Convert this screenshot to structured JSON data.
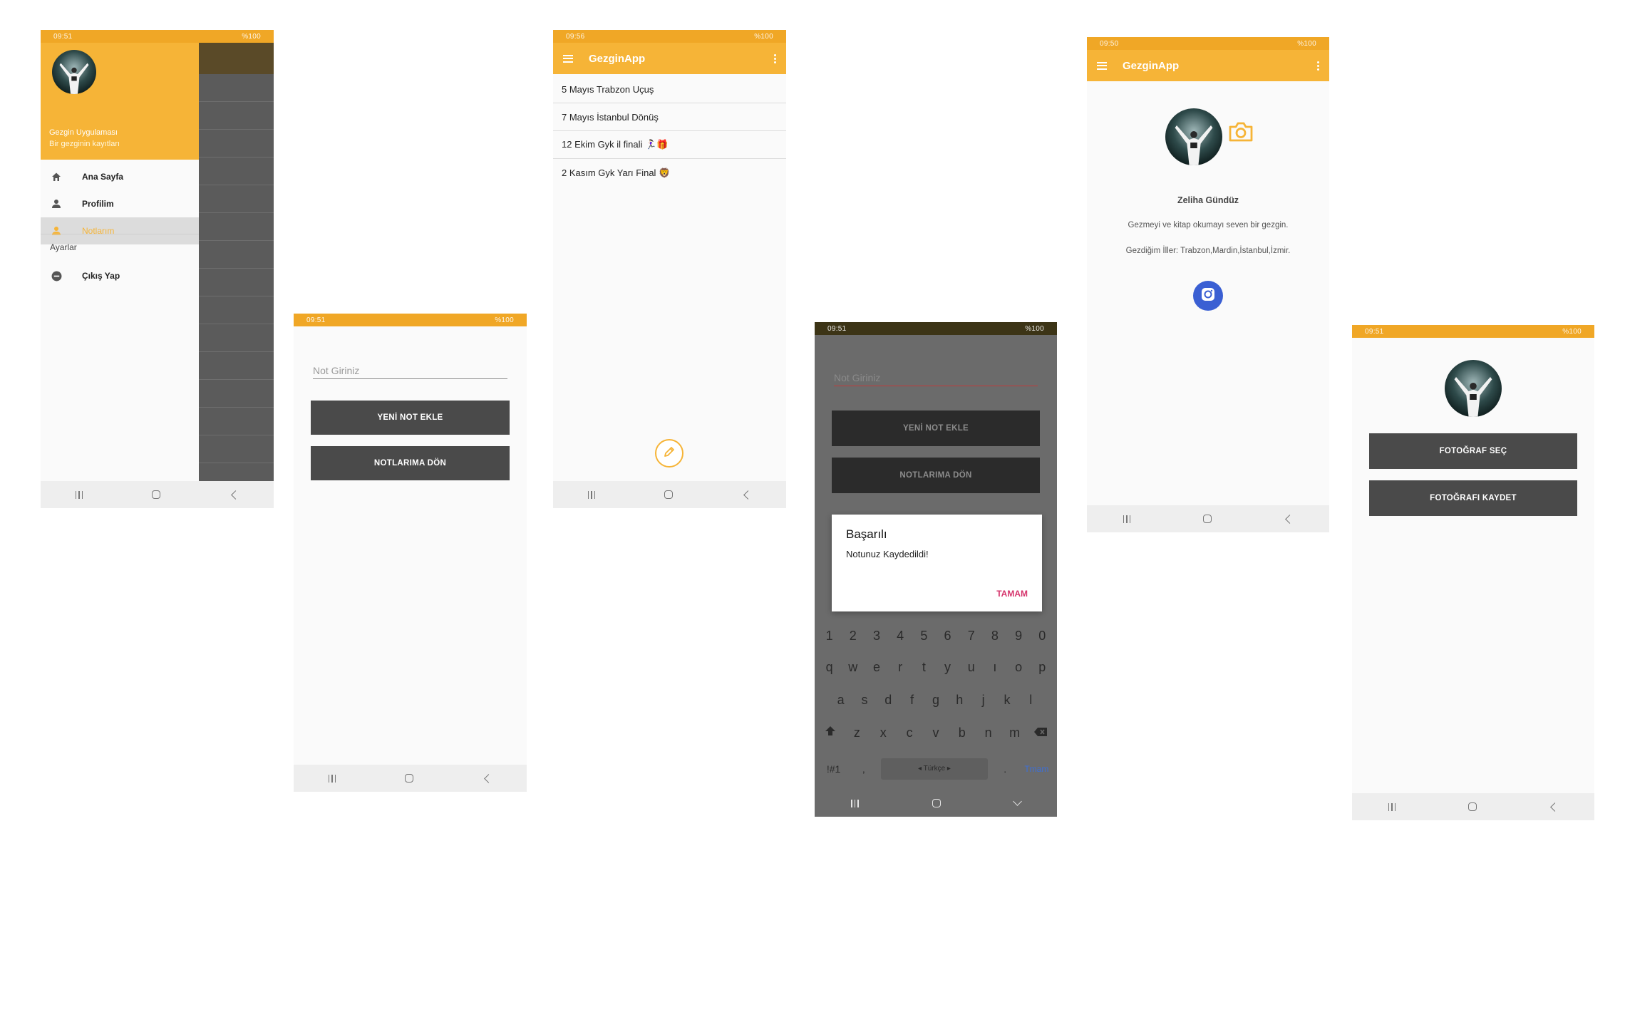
{
  "colors": {
    "accent": "#f6b437",
    "dark_button": "#4a4a4a",
    "dialog_action": "#d5336b",
    "instagram": "#3a5fd3"
  },
  "screens": {
    "drawer": {
      "status_time": "09:51",
      "status_right": "%100",
      "header_title": "Gezgin Uygulaması",
      "header_subtitle": "Bir gezginin kayıtları",
      "menu": [
        {
          "label": "Ana Sayfa",
          "icon": "home-icon"
        },
        {
          "label": "Profilim",
          "icon": "person-icon"
        },
        {
          "label": "Notlarım",
          "icon": "person-icon",
          "active": true
        }
      ],
      "section_label": "Ayarlar",
      "logout_label": "Çıkış Yap"
    },
    "add_note": {
      "status_time": "09:51",
      "status_right": "%100",
      "input_placeholder": "Not Giriniz",
      "add_button": "YENİ NOT EKLE",
      "back_button": "NOTLARIMA DÖN"
    },
    "notes_list": {
      "status_time": "09:56",
      "status_right": "%100",
      "app_title": "GezginApp",
      "items": [
        "5 Mayıs Trabzon Uçuş",
        "7 Mayıs İstanbul Dönüş",
        "12 Ekim Gyk il finali 🏃🏻‍♀️🎁",
        "2 Kasım Gyk Yarı Final 🦁"
      ]
    },
    "saved_dialog": {
      "status_time": "09:51",
      "status_right": "%100",
      "input_placeholder": "Not Giriniz",
      "add_button": "YENİ NOT EKLE",
      "back_button": "NOTLARIMA DÖN",
      "dialog_title": "Başarılı",
      "dialog_message": "Notunuz Kaydedildi!",
      "dialog_button": "TAMAM",
      "keyboard": {
        "numbers": [
          "1",
          "2",
          "3",
          "4",
          "5",
          "6",
          "7",
          "8",
          "9",
          "0"
        ],
        "row1": [
          "q",
          "w",
          "e",
          "r",
          "t",
          "y",
          "u",
          "ı",
          "o",
          "p"
        ],
        "row2": [
          "a",
          "s",
          "d",
          "f",
          "g",
          "h",
          "j",
          "k",
          "l"
        ],
        "row3": [
          "z",
          "x",
          "c",
          "v",
          "b",
          "n",
          "m"
        ],
        "sym": "!#1",
        "comma": ",",
        "space": "◂ Türkçe ▸",
        "dot": ".",
        "done": "Tmam"
      }
    },
    "profile": {
      "status_time": "09:50",
      "status_right": "%100",
      "app_title": "GezginApp",
      "name": "Zeliha Gündüz",
      "bio": "Gezmeyi ve kitap okumayı seven bir gezgin.",
      "cities": "Gezdiğim İller: Trabzon,Mardin,İstanbul,İzmir."
    },
    "photo": {
      "status_time": "09:51",
      "status_right": "%100",
      "select_button": "FOTOĞRAF SEÇ",
      "save_button": "FOTOĞRAFI KAYDET"
    }
  }
}
